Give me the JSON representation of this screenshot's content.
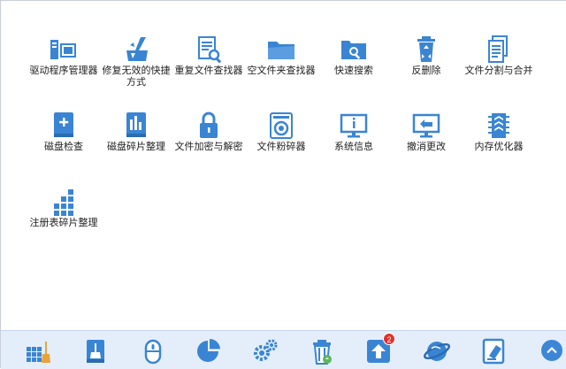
{
  "accent_color": "#3a85d3",
  "tools": [
    {
      "icon": "driver-manager-icon",
      "label": "驱动程序管理器"
    },
    {
      "icon": "repair-shortcut-icon",
      "label": "修复无效的快捷方式"
    },
    {
      "icon": "duplicate-file-finder-icon",
      "label": "重复文件查找器"
    },
    {
      "icon": "empty-folder-finder-icon",
      "label": "空文件夹查找器"
    },
    {
      "icon": "quick-search-icon",
      "label": "快速搜索"
    },
    {
      "icon": "undelete-icon",
      "label": "反删除"
    },
    {
      "icon": "file-split-merge-icon",
      "label": "文件分割与合并"
    },
    {
      "icon": "disk-check-icon",
      "label": "磁盘检查"
    },
    {
      "icon": "disk-defrag-icon",
      "label": "磁盘碎片整理"
    },
    {
      "icon": "file-encrypt-lock-icon",
      "label": "文件加密与解密"
    },
    {
      "icon": "file-shredder-icon",
      "label": "文件粉碎器"
    },
    {
      "icon": "system-info-icon",
      "label": "系统信息"
    },
    {
      "icon": "undo-changes-icon",
      "label": "撤消更改"
    },
    {
      "icon": "memory-optimizer-icon",
      "label": "内存优化器"
    },
    {
      "icon": "registry-defrag-icon",
      "label": "注册表碎片整理"
    }
  ],
  "taskbar": [
    {
      "icon": "cleaner-grid-broom-icon"
    },
    {
      "icon": "disk-broom-icon"
    },
    {
      "icon": "mouse-icon"
    },
    {
      "icon": "pie-chart-icon"
    },
    {
      "icon": "gears-icon"
    },
    {
      "icon": "recycle-bin-icon"
    },
    {
      "icon": "update-upload-icon",
      "badge": "2"
    },
    {
      "icon": "internet-globe-icon"
    },
    {
      "icon": "privacy-eraser-icon"
    }
  ],
  "collapse_icon": "chevron-up-icon"
}
